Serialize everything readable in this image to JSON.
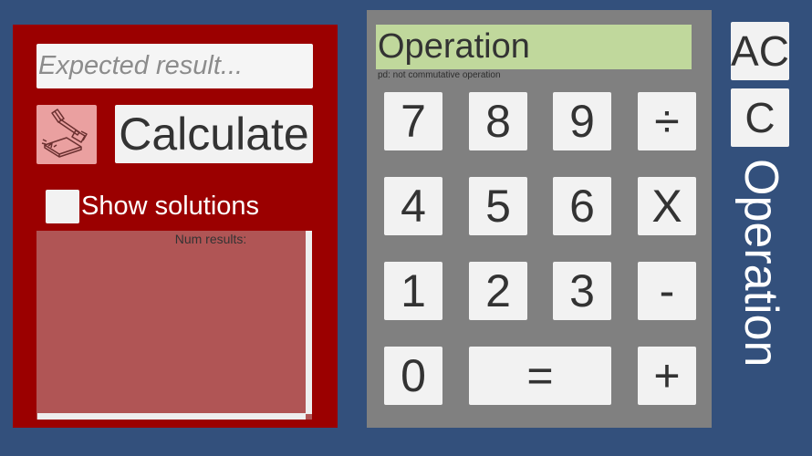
{
  "input": {
    "placeholder": "Expected result...",
    "value": ""
  },
  "hammer": {
    "icon": "gavel-icon"
  },
  "calculate_label": "Calculate",
  "show_solutions": {
    "label": "Show solutions",
    "checked": false
  },
  "results": {
    "header": "Num results:"
  },
  "display": {
    "text": "Operation",
    "note": "pd: not commutative operation"
  },
  "keys": {
    "k7": "7",
    "k8": "8",
    "k9": "9",
    "div": "÷",
    "k4": "4",
    "k5": "5",
    "k6": "6",
    "mul": "X",
    "k1": "1",
    "k2": "2",
    "k3": "3",
    "sub": "-",
    "k0": "0",
    "eq": "=",
    "add": "+"
  },
  "side": {
    "ac": "AC",
    "c": "C",
    "label": "Operation"
  },
  "colors": {
    "background": "#33507c",
    "left_panel": "#9b0000",
    "calc_panel": "#808080",
    "display": "#c0d89c",
    "results_area": "#b05555",
    "hammer_button": "#eaa0a0"
  }
}
